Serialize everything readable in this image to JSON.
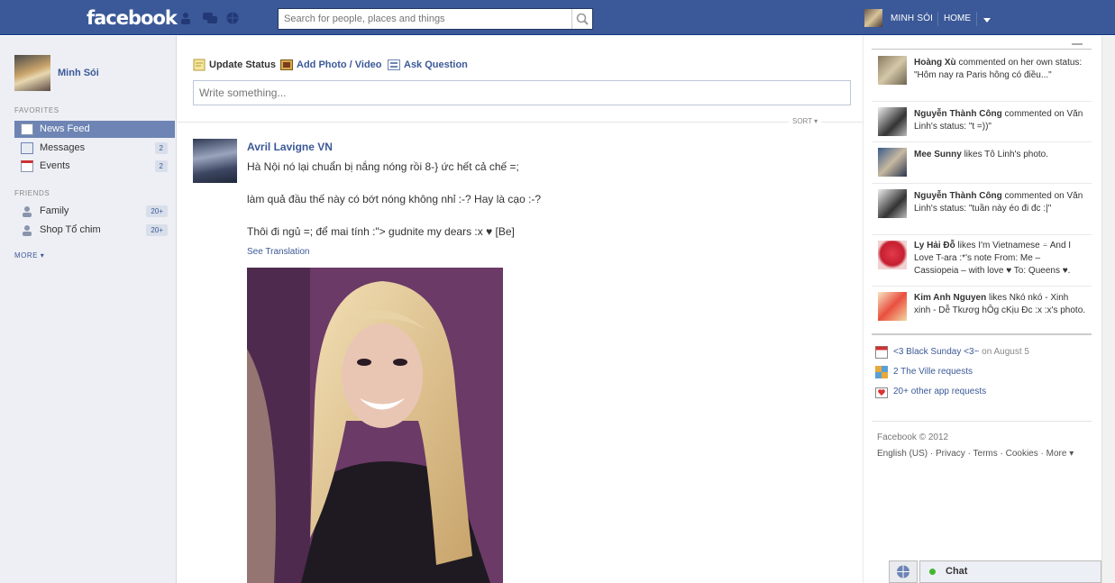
{
  "topbar": {
    "logo": "facebook",
    "search_placeholder": "Search for people, places and things",
    "user_name": "MINH SÓI",
    "home": "HOME",
    "icons": [
      "friend-requests-icon",
      "messages-icon",
      "notifications-icon",
      "search-icon",
      "account-menu-chevron-icon"
    ]
  },
  "sidebar": {
    "profile_name": "Minh Sói",
    "favorites_label": "FAVORITES",
    "favorites": [
      {
        "label": "News Feed",
        "count": ""
      },
      {
        "label": "Messages",
        "count": "2"
      },
      {
        "label": "Events",
        "count": "2"
      }
    ],
    "friends_label": "FRIENDS",
    "friends": [
      {
        "label": "Family",
        "count": "20+"
      },
      {
        "label": "Shop Tổ chim",
        "count": "20+"
      }
    ],
    "more": "MORE"
  },
  "composer": {
    "tabs": [
      "Update Status",
      "Add Photo / Video",
      "Ask Question"
    ],
    "placeholder": "Write something..."
  },
  "feed": {
    "sort": "SORT",
    "post": {
      "author": "Avril Lavigne VN",
      "lines": [
        "Hà Nội nó lại chuẩn bị nắng nóng rồi 8-} ức hết cả chế =;",
        "làm quả đầu thế này có bớt nóng không nhỉ :-? Hay là cạo :-?",
        "Thôi đi ngủ =; để mai tính :\"> gudnite my dears :x ♥ [Be]"
      ],
      "see_translation": "See Translation"
    }
  },
  "ticker": [
    {
      "name": "Hoàng Xù",
      "text": " commented on her own status: \"Hôm nay ra Paris hông có điều...\""
    },
    {
      "name": "Nguyễn Thành Công",
      "text": " commented on Văn Linh's status: \"t =))\""
    },
    {
      "name": "Mee Sunny",
      "text": " likes Tô Linh's photo."
    },
    {
      "name": "Nguyễn Thành Công",
      "text": " commented on Văn Linh's status: \"tuần này éo đi đc :|\""
    },
    {
      "name": "Ly Hải Đỗ",
      "text": " likes I'm Vietnamese ⍨ And I Love T-ara :*'s note From: Me – Cassiopeia – with love ♥ To: Queens ♥."
    },
    {
      "name": "Kim Anh Nguyen",
      "text": " likes Nkó nkó - Xinh xinh - Dễ Tkươg hÔg cKịu Đc :x :x's photo."
    }
  ],
  "requests": [
    {
      "text": "<3 Black Sunday <3~",
      "suffix": " on August 5"
    },
    {
      "text": "2 The Ville requests",
      "suffix": ""
    },
    {
      "text": "20+ other app requests",
      "suffix": ""
    }
  ],
  "footer": {
    "copyright": "Facebook © 2012",
    "links": "English (US) · Privacy · Terms · Cookies · More ▾"
  },
  "chat": {
    "label": "Chat"
  }
}
